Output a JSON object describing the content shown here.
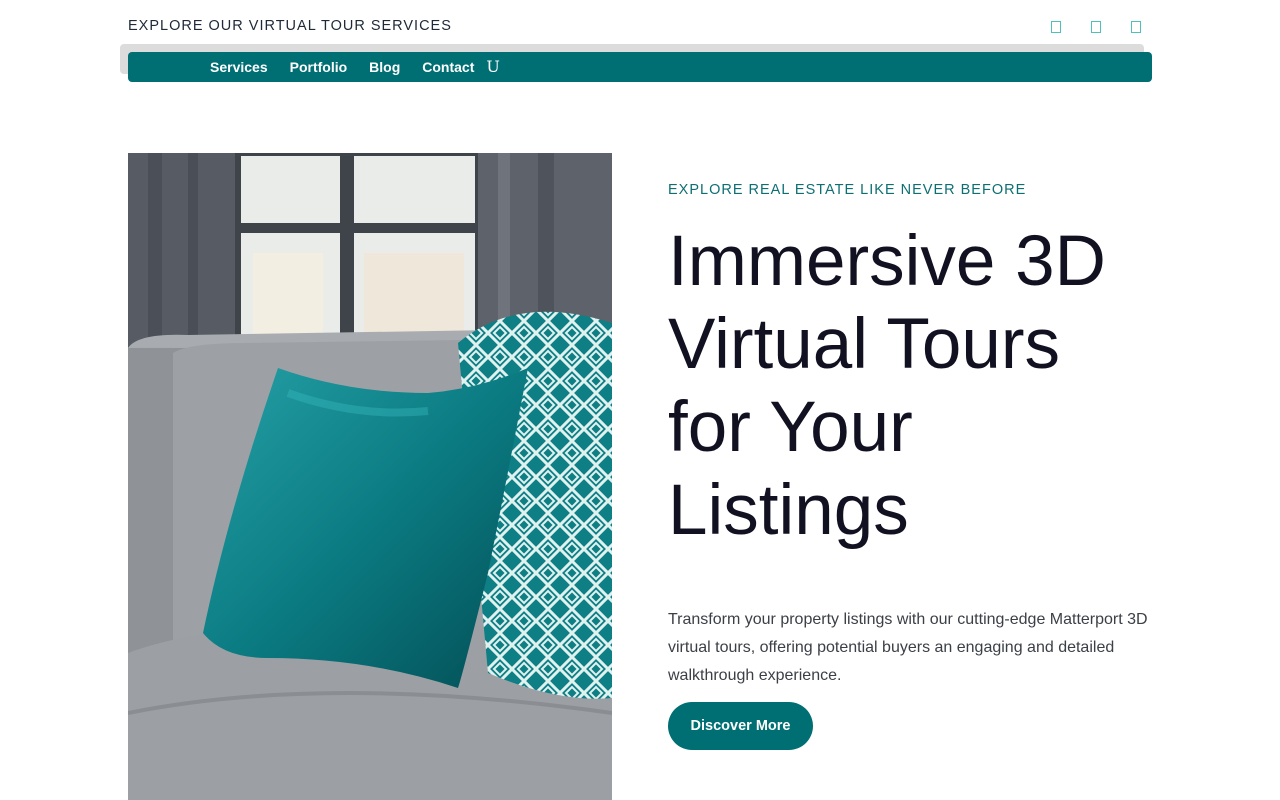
{
  "topbar": {
    "text": "EXPLORE OUR VIRTUAL TOUR SERVICES",
    "social_icons": [
      "social-icon-1",
      "social-icon-2",
      "social-icon-3"
    ]
  },
  "nav": {
    "items": [
      "Services",
      "Portfolio",
      "Blog",
      "Contact"
    ],
    "search_glyph": "U",
    "bg_color": "#006f74"
  },
  "hero": {
    "image_alt": "Gray sofa with teal velvet pillow and teal geometric patterned pillow by a window",
    "eyebrow": "EXPLORE REAL ESTATE LIKE NEVER BEFORE",
    "title_lines": [
      "Immersive 3D",
      "Virtual Tours",
      "for Your",
      "Listings"
    ],
    "description": "Transform your property listings with our cutting-edge Matterport 3D virtual tours, offering potential buyers an engaging and detailed walkthrough experience.",
    "cta_label": "Discover More"
  },
  "colors": {
    "accent": "#006f74",
    "eyebrow": "#0e6f73",
    "heading": "#111122",
    "body": "#3b3f46"
  }
}
